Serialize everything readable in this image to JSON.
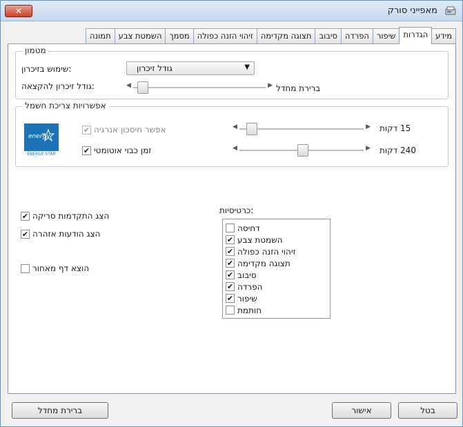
{
  "window": {
    "title": "מאפייני סורק",
    "close_label": "✕"
  },
  "tabs": [
    {
      "label": "מידע",
      "active": false
    },
    {
      "label": "הגדרות",
      "active": true
    },
    {
      "label": "שיפור",
      "active": false
    },
    {
      "label": "הפרדה",
      "active": false
    },
    {
      "label": "סיבוב",
      "active": false
    },
    {
      "label": "תצוגה מקדימה",
      "active": false
    },
    {
      "label": "זיהוי הזנה כפולה",
      "active": false
    },
    {
      "label": "מסמך",
      "active": false
    },
    {
      "label": "השמטת צבע",
      "active": false
    },
    {
      "label": "תמונה",
      "active": false
    }
  ],
  "buffer_group": {
    "title": "מטמון",
    "memory_usage_label": ":שימוש בזיכרון",
    "memory_usage_value": "גודל זיכרון",
    "allocation_label": ":גודל זיכרון להקצאה",
    "default_label": "ברירת מחדל"
  },
  "power_group": {
    "title": "אפשרויות צריכת חשמל",
    "energy_saving_label": "אפשר חיסכון אנרגיה",
    "energy_saving_checked": true,
    "energy_saving_value": "15 דקות",
    "auto_off_label": "זמן כבוי אוטומטי",
    "auto_off_checked": true,
    "auto_off_value": "240 דקות",
    "logo_text": "energy",
    "logo_caption": "ENERGY STAR"
  },
  "options": {
    "show_progress_label": "הצג התקדמות סריקה",
    "show_progress_checked": true,
    "show_warnings_label": "הצג הודעות אזהרה",
    "show_warnings_checked": true,
    "eject_label": "הוצא דף מאחור",
    "eject_checked": false
  },
  "tabs_list": {
    "title": ":כרטיסיות",
    "items": [
      {
        "label": "דחיסה",
        "checked": false
      },
      {
        "label": "השמטת צבע",
        "checked": true
      },
      {
        "label": "זיהוי הזנה כפולה",
        "checked": true
      },
      {
        "label": "תצוגה מקדימה",
        "checked": true
      },
      {
        "label": "סיבוב",
        "checked": true
      },
      {
        "label": "הפרדה",
        "checked": true
      },
      {
        "label": "שיפור",
        "checked": true
      },
      {
        "label": "חותמת",
        "checked": false
      }
    ]
  },
  "buttons": {
    "default_label": "ברירת מחדל",
    "ok_label": "אישור",
    "cancel_label": "בטל"
  },
  "check_glyph": "✔"
}
